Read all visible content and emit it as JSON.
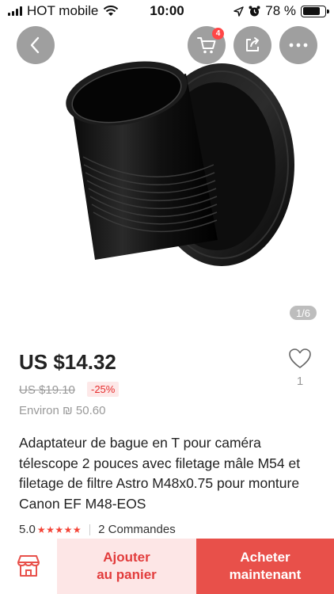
{
  "status_bar": {
    "carrier": "HOT mobile",
    "time": "10:00",
    "battery_percent": "78 %",
    "battery_level": 0.78
  },
  "image_area": {
    "pager": "1/6",
    "cart_badge": "4"
  },
  "product": {
    "price": "US $14.32",
    "original_price": "US $19.10",
    "discount": "-25%",
    "approx_price": "Environ ₪ 50.60",
    "wishlist_count": "1",
    "title": "Adaptateur de bague en T pour caméra télescope 2 pouces avec filetage mâle M54 et filetage de filtre Astro M48x0.75 pour monture Canon EF M48-EOS",
    "rating": "5.0",
    "stars": "★★★★★",
    "orders": "2 Commandes"
  },
  "bottom_bar": {
    "add_to_cart_line1": "Ajouter",
    "add_to_cart_line2": "au panier",
    "buy_now_line1": "Acheter",
    "buy_now_line2": "maintenant"
  },
  "colors": {
    "accent": "#e8504a",
    "accent_light": "#fde6e6",
    "badge": "#ff4747",
    "stars": "#f44336"
  },
  "icons": [
    "signal-icon",
    "wifi-icon",
    "location-icon",
    "alarm-icon",
    "battery-icon",
    "back-icon",
    "cart-icon",
    "share-icon",
    "more-icon",
    "heart-icon",
    "store-icon"
  ]
}
